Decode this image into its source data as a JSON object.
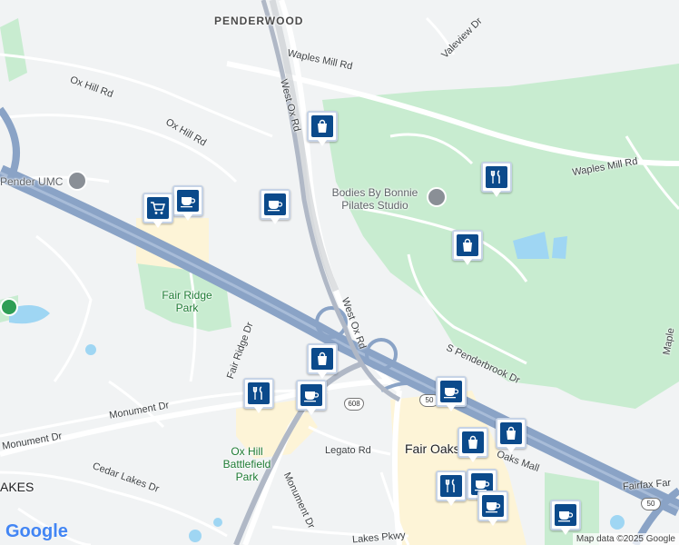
{
  "map": {
    "neighborhoods": [
      "PENDERWOOD"
    ],
    "roads": [
      "Waples Mill Rd",
      "Waples Mill Rd",
      "West Ox Rd",
      "West Ox Rd",
      "Ox Hill Rd",
      "Ox Hill Rd",
      "Valeview Dr",
      "Fair Ridge Dr",
      "Monument Dr",
      "Monument Dr",
      "Monument Dr",
      "Cedar Lakes Dr",
      "Legato Rd",
      "S Penderbrook Dr",
      "Fairfax Far",
      "Maple",
      "Lakes Pkwy",
      "Oaks Mall"
    ],
    "parks": [
      "Fair Ridge Park",
      "Ox Hill Battlefield Park"
    ],
    "places": [
      "Bodies By Bonnie Pilates Studio",
      "Pender UMC",
      "Fair Oaks",
      "AKES"
    ],
    "shields": [
      "50",
      "608",
      "50"
    ],
    "pins": [
      {
        "name": "shopping-bag-icon"
      },
      {
        "name": "restaurant-icon"
      },
      {
        "name": "shopping-bag-icon"
      },
      {
        "name": "coffee-icon"
      },
      {
        "name": "coffee-icon"
      },
      {
        "name": "shopping-cart-icon"
      },
      {
        "name": "shopping-bag-icon"
      },
      {
        "name": "restaurant-icon"
      },
      {
        "name": "coffee-icon"
      },
      {
        "name": "coffee-icon"
      },
      {
        "name": "shopping-bag-icon"
      },
      {
        "name": "shopping-bag-icon"
      },
      {
        "name": "restaurant-icon"
      },
      {
        "name": "coffee-icon"
      },
      {
        "name": "coffee-icon"
      },
      {
        "name": "coffee-icon"
      }
    ],
    "logo": "Google",
    "attribution": "Map data ©2025 Google",
    "colors": {
      "park": "#c8ecd0",
      "water": "#9fd6f3",
      "highway": "#8aa3c6",
      "land": "#f1f3f4",
      "pin": "#0b4a8b"
    }
  }
}
